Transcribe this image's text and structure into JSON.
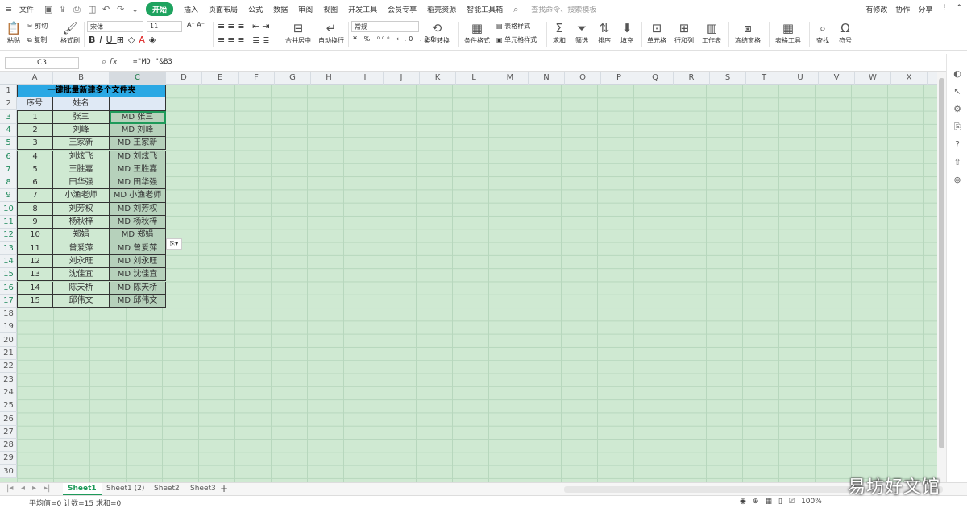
{
  "menu": {
    "file": "文件",
    "tabs": [
      "开始",
      "插入",
      "页面布局",
      "公式",
      "数据",
      "审阅",
      "视图",
      "开发工具",
      "会员专享",
      "稻壳资源",
      "智能工具箱"
    ],
    "active_tab": "开始",
    "search_placeholder": "查找命令、搜索模板",
    "has_changes": "有修改",
    "collab": "协作",
    "share": "分享"
  },
  "ribbon": {
    "paste": "粘贴",
    "cut": "剪切",
    "copy": "复制",
    "format_painter": "格式刷",
    "font_name": "宋体",
    "font_size": "11",
    "merge": "合并居中",
    "wrap": "自动换行",
    "number_format": "常规",
    "type_convert": "类型转换",
    "cond_format": "条件格式",
    "table_style": "表格样式",
    "cell_style": "单元格样式",
    "sum": "求和",
    "filter": "筛选",
    "sort": "排序",
    "fill": "填充",
    "cells": "单元格",
    "rowcol": "行和列",
    "worksheet": "工作表",
    "freeze": "冻结窗格",
    "table_tools": "表格工具",
    "find": "查找",
    "symbol": "符号"
  },
  "formula_bar": {
    "name_box": "C3",
    "fx": "fx",
    "formula": "=\"MD \"&B3"
  },
  "columns": [
    "A",
    "B",
    "C",
    "D",
    "E",
    "F",
    "G",
    "H",
    "I",
    "J",
    "K",
    "L",
    "M",
    "N",
    "O",
    "P",
    "Q",
    "R",
    "S",
    "T",
    "U",
    "V",
    "W",
    "X"
  ],
  "rows": [
    "1",
    "2",
    "3",
    "4",
    "5",
    "6",
    "7",
    "8",
    "9",
    "10",
    "11",
    "12",
    "13",
    "14",
    "15",
    "16",
    "17",
    "18",
    "19",
    "20",
    "21",
    "22",
    "23",
    "24",
    "25",
    "26",
    "27",
    "28",
    "29",
    "30"
  ],
  "table": {
    "title": "一键批量新建多个文件夹",
    "header_no": "序号",
    "header_name": "姓名",
    "rows": [
      {
        "no": "1",
        "name": "张三",
        "cmd": "MD 张三"
      },
      {
        "no": "2",
        "name": "刘峰",
        "cmd": "MD 刘峰"
      },
      {
        "no": "3",
        "name": "王家新",
        "cmd": "MD 王家新"
      },
      {
        "no": "4",
        "name": "刘炫飞",
        "cmd": "MD 刘炫飞"
      },
      {
        "no": "5",
        "name": "王胜嘉",
        "cmd": "MD 王胜嘉"
      },
      {
        "no": "6",
        "name": "田华强",
        "cmd": "MD 田华强"
      },
      {
        "no": "7",
        "name": "小渔老师",
        "cmd": "MD 小渔老师"
      },
      {
        "no": "8",
        "name": "刘芳权",
        "cmd": "MD 刘芳权"
      },
      {
        "no": "9",
        "name": "杨秋梓",
        "cmd": "MD 杨秋梓"
      },
      {
        "no": "10",
        "name": "郑娟",
        "cmd": "MD 郑娟"
      },
      {
        "no": "11",
        "name": "曾爱萍",
        "cmd": "MD 曾爱萍"
      },
      {
        "no": "12",
        "name": "刘永旺",
        "cmd": "MD 刘永旺"
      },
      {
        "no": "13",
        "name": "沈佳宜",
        "cmd": "MD 沈佳宜"
      },
      {
        "no": "14",
        "name": "陈天桥",
        "cmd": "MD 陈天桥"
      },
      {
        "no": "15",
        "name": "邱伟文",
        "cmd": "MD 邱伟文"
      }
    ]
  },
  "sheets": [
    "Sheet1",
    "Sheet1 (2)",
    "Sheet2",
    "Sheet3"
  ],
  "active_sheet": "Sheet1",
  "status": {
    "left": "平均值=0  计数=15  求和=0",
    "zoom": "100%"
  },
  "watermark": "易坊好文馆",
  "colors": {
    "accent": "#1ea35f",
    "title_fill": "#2aa8e4",
    "sheet_bg": "#cfe9d2"
  }
}
